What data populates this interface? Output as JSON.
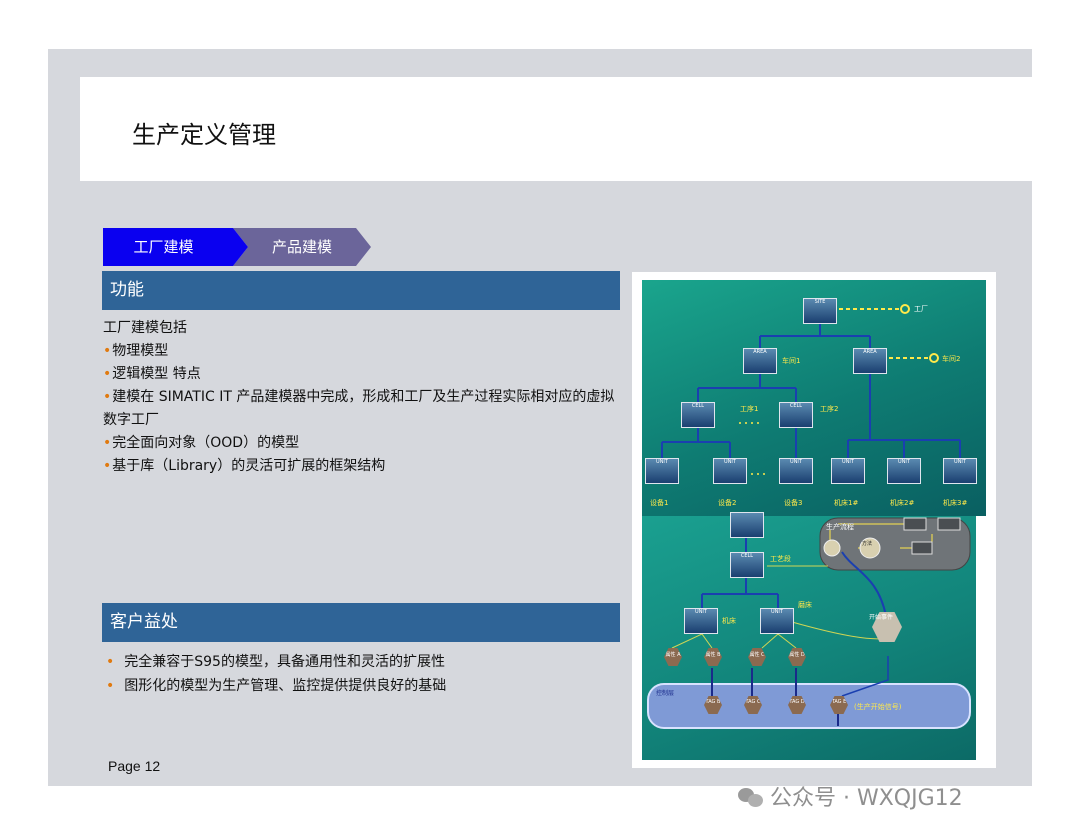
{
  "slide": {
    "title": "生产定义管理",
    "tabs": [
      "工厂建模",
      "产品建模"
    ],
    "section1": {
      "heading": "功能",
      "intro": "工厂建模包括",
      "items": [
        "物理模型",
        "逻辑模型 特点",
        "建模在 SIMATIC IT 产品建模器中完成，形成和工厂及生产过程实际相对应的虚拟数字工厂",
        "完全面向对象（OOD）的模型",
        "基于库（Library）的灵活可扩展的框架结构"
      ]
    },
    "section2": {
      "heading": "客户益处",
      "items": [
        "完全兼容于S95的模型，具备通用性和灵活的扩展性",
        "图形化的模型为生产管理、监控提供提供良好的基础"
      ]
    },
    "page": "Page 12"
  },
  "diagram_top": {
    "site_label": "SITE",
    "site_name": "工厂",
    "area_label": "AREA",
    "area_names": [
      "车间1",
      "车间2"
    ],
    "cell_label": "CELL",
    "cell_names": [
      "工序1",
      "工序2"
    ],
    "unit_label": "UNIT",
    "unit_names": [
      "设备1",
      "设备2",
      "设备3",
      "机床1#",
      "机床2#",
      "机床3#"
    ]
  },
  "diagram_bottom": {
    "process_title": "生产流程",
    "method_label": "方法",
    "cell_name": "工艺段",
    "unit_name_left": "机床",
    "unit_name_right": "磨床",
    "start_event": "开始事件",
    "properties": [
      "属性 A",
      "属性 B",
      "属性 C",
      "属性 D"
    ],
    "tags": [
      "TAG B",
      "TAG C",
      "TAG D",
      "TAG E"
    ],
    "control_layer": "控制层",
    "signal": "(生产开始信号)"
  },
  "watermark": "公众号 · WXQJG12",
  "colors": {
    "tab_active": "#0a00f0",
    "tab_inactive": "#6b659a",
    "section_head": "#2f6497",
    "bullet": "#e07a10",
    "diagram_teal": "#0e7b72"
  }
}
